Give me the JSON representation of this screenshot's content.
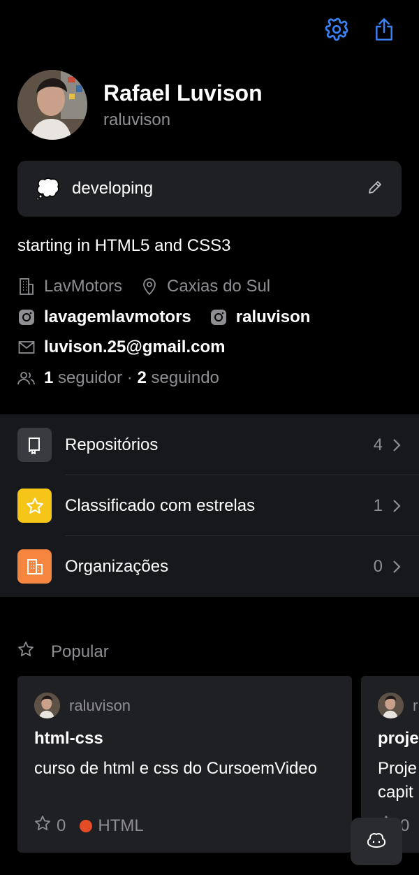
{
  "header": {
    "settings_icon": "gear-icon",
    "share_icon": "share-icon"
  },
  "profile": {
    "full_name": "Rafael Luvison",
    "username": "raluvison"
  },
  "status": {
    "emoji": "💭",
    "text": "developing"
  },
  "bio": "starting in HTML5 and CSS3",
  "details": {
    "company": "LavMotors",
    "location": "Caxias do Sul",
    "instagram_1": "lavagemlavmotors",
    "instagram_2": "raluvison",
    "email": "luvison.25@gmail.com",
    "followers_count": "1",
    "followers_label": "seguidor",
    "separator": "·",
    "following_count": "2",
    "following_label": "seguindo"
  },
  "menu": {
    "items": [
      {
        "label": "Repositórios",
        "count": "4",
        "icon": "repo-icon",
        "color": "#3a3b40"
      },
      {
        "label": "Classificado com estrelas",
        "count": "1",
        "icon": "star-icon",
        "color": "#f5c518"
      },
      {
        "label": "Organizações",
        "count": "0",
        "icon": "organization-icon",
        "color": "#f5853f"
      }
    ]
  },
  "popular": {
    "title": "Popular",
    "cards": [
      {
        "owner": "raluvison",
        "title": "html-css",
        "description": "curso de html e css do CursoemVideo",
        "stars": "0",
        "language": "HTML",
        "language_color": "#e34c26"
      },
      {
        "owner": "r",
        "title": "proje",
        "description": "Proje capit",
        "stars": "0"
      }
    ]
  },
  "fab": {
    "icon": "copilot-icon"
  }
}
